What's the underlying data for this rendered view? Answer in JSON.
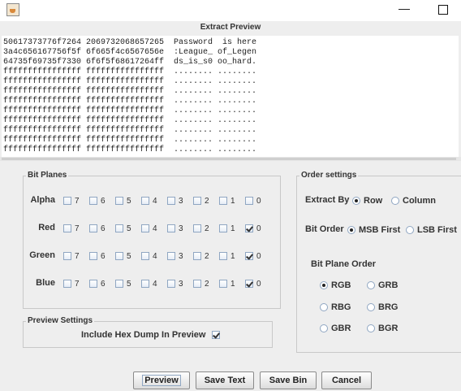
{
  "window": {
    "minimize_glyph": "—",
    "app_icon": "java-cup-icon"
  },
  "panel_title": "Extract Preview",
  "preview_lines": [
    "50617373776f7264 2069732068657265  Password  is here",
    "3a4c656167756f5f 6f665f4c6567656e  :League_ of_Legen",
    "64735f69735f7330 6f6f5f68617264ff  ds_is_s0 oo_hard.",
    "ffffffffffffffff ffffffffffffffff  ........ ........",
    "ffffffffffffffff ffffffffffffffff  ........ ........",
    "ffffffffffffffff ffffffffffffffff  ........ ........",
    "ffffffffffffffff ffffffffffffffff  ........ ........",
    "ffffffffffffffff ffffffffffffffff  ........ ........",
    "ffffffffffffffff ffffffffffffffff  ........ ........",
    "ffffffffffffffff ffffffffffffffff  ........ ........",
    "ffffffffffffffff ffffffffffffffff  ........ ........",
    "ffffffffffffffff ffffffffffffffff  ........ ........"
  ],
  "bit_planes": {
    "title": "Bit Planes",
    "bits": [
      "7",
      "6",
      "5",
      "4",
      "3",
      "2",
      "1",
      "0"
    ],
    "rows": [
      {
        "label": "Alpha",
        "checked": []
      },
      {
        "label": "Red",
        "checked": [
          "0"
        ]
      },
      {
        "label": "Green",
        "checked": [
          "0"
        ]
      },
      {
        "label": "Blue",
        "checked": [
          "0"
        ]
      }
    ]
  },
  "preview_settings": {
    "title": "Preview Settings",
    "hex_dump_label": "Include Hex Dump In Preview",
    "hex_dump_checked": true
  },
  "order_settings": {
    "title": "Order settings",
    "extract_by_label": "Extract By",
    "extract_by_options": [
      "Row",
      "Column"
    ],
    "extract_by_selected": "Row",
    "bit_order_label": "Bit Order",
    "bit_order_options": [
      "MSB First",
      "LSB First"
    ],
    "bit_order_selected": "MSB First",
    "bit_plane_order_label": "Bit Plane Order",
    "bit_plane_order_options": [
      "RGB",
      "GRB",
      "RBG",
      "BRG",
      "GBR",
      "BGR"
    ],
    "bit_plane_order_selected": "RGB"
  },
  "buttons": {
    "preview": "Preview",
    "save_text": "Save Text",
    "save_bin": "Save Bin",
    "cancel": "Cancel"
  }
}
